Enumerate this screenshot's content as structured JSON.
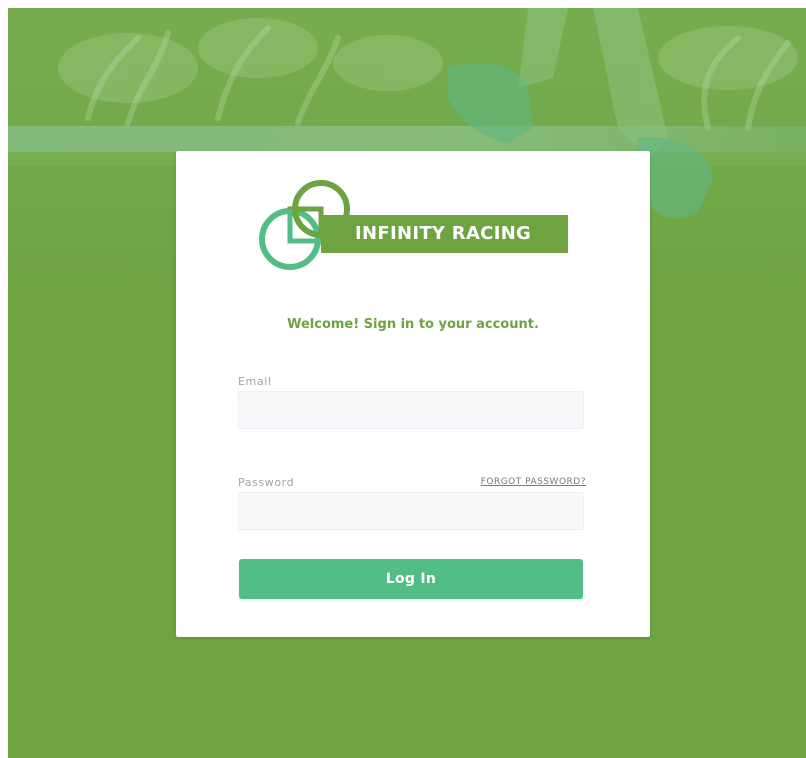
{
  "brand": {
    "name": "INFINITY RACING",
    "primary_color": "#6da341",
    "accent_color": "#52bd86",
    "logo_icon": "infinity-racing-logo"
  },
  "background": {
    "image": "runner-on-track-photo",
    "overlay_color": "#6da341"
  },
  "login": {
    "welcome": "Welcome! Sign in to your account.",
    "email_label": "Email",
    "email_value": "",
    "password_label": "Password",
    "password_value": "",
    "forgot_password": "FORGOT PASSWORD?",
    "submit_label": "Log In"
  }
}
